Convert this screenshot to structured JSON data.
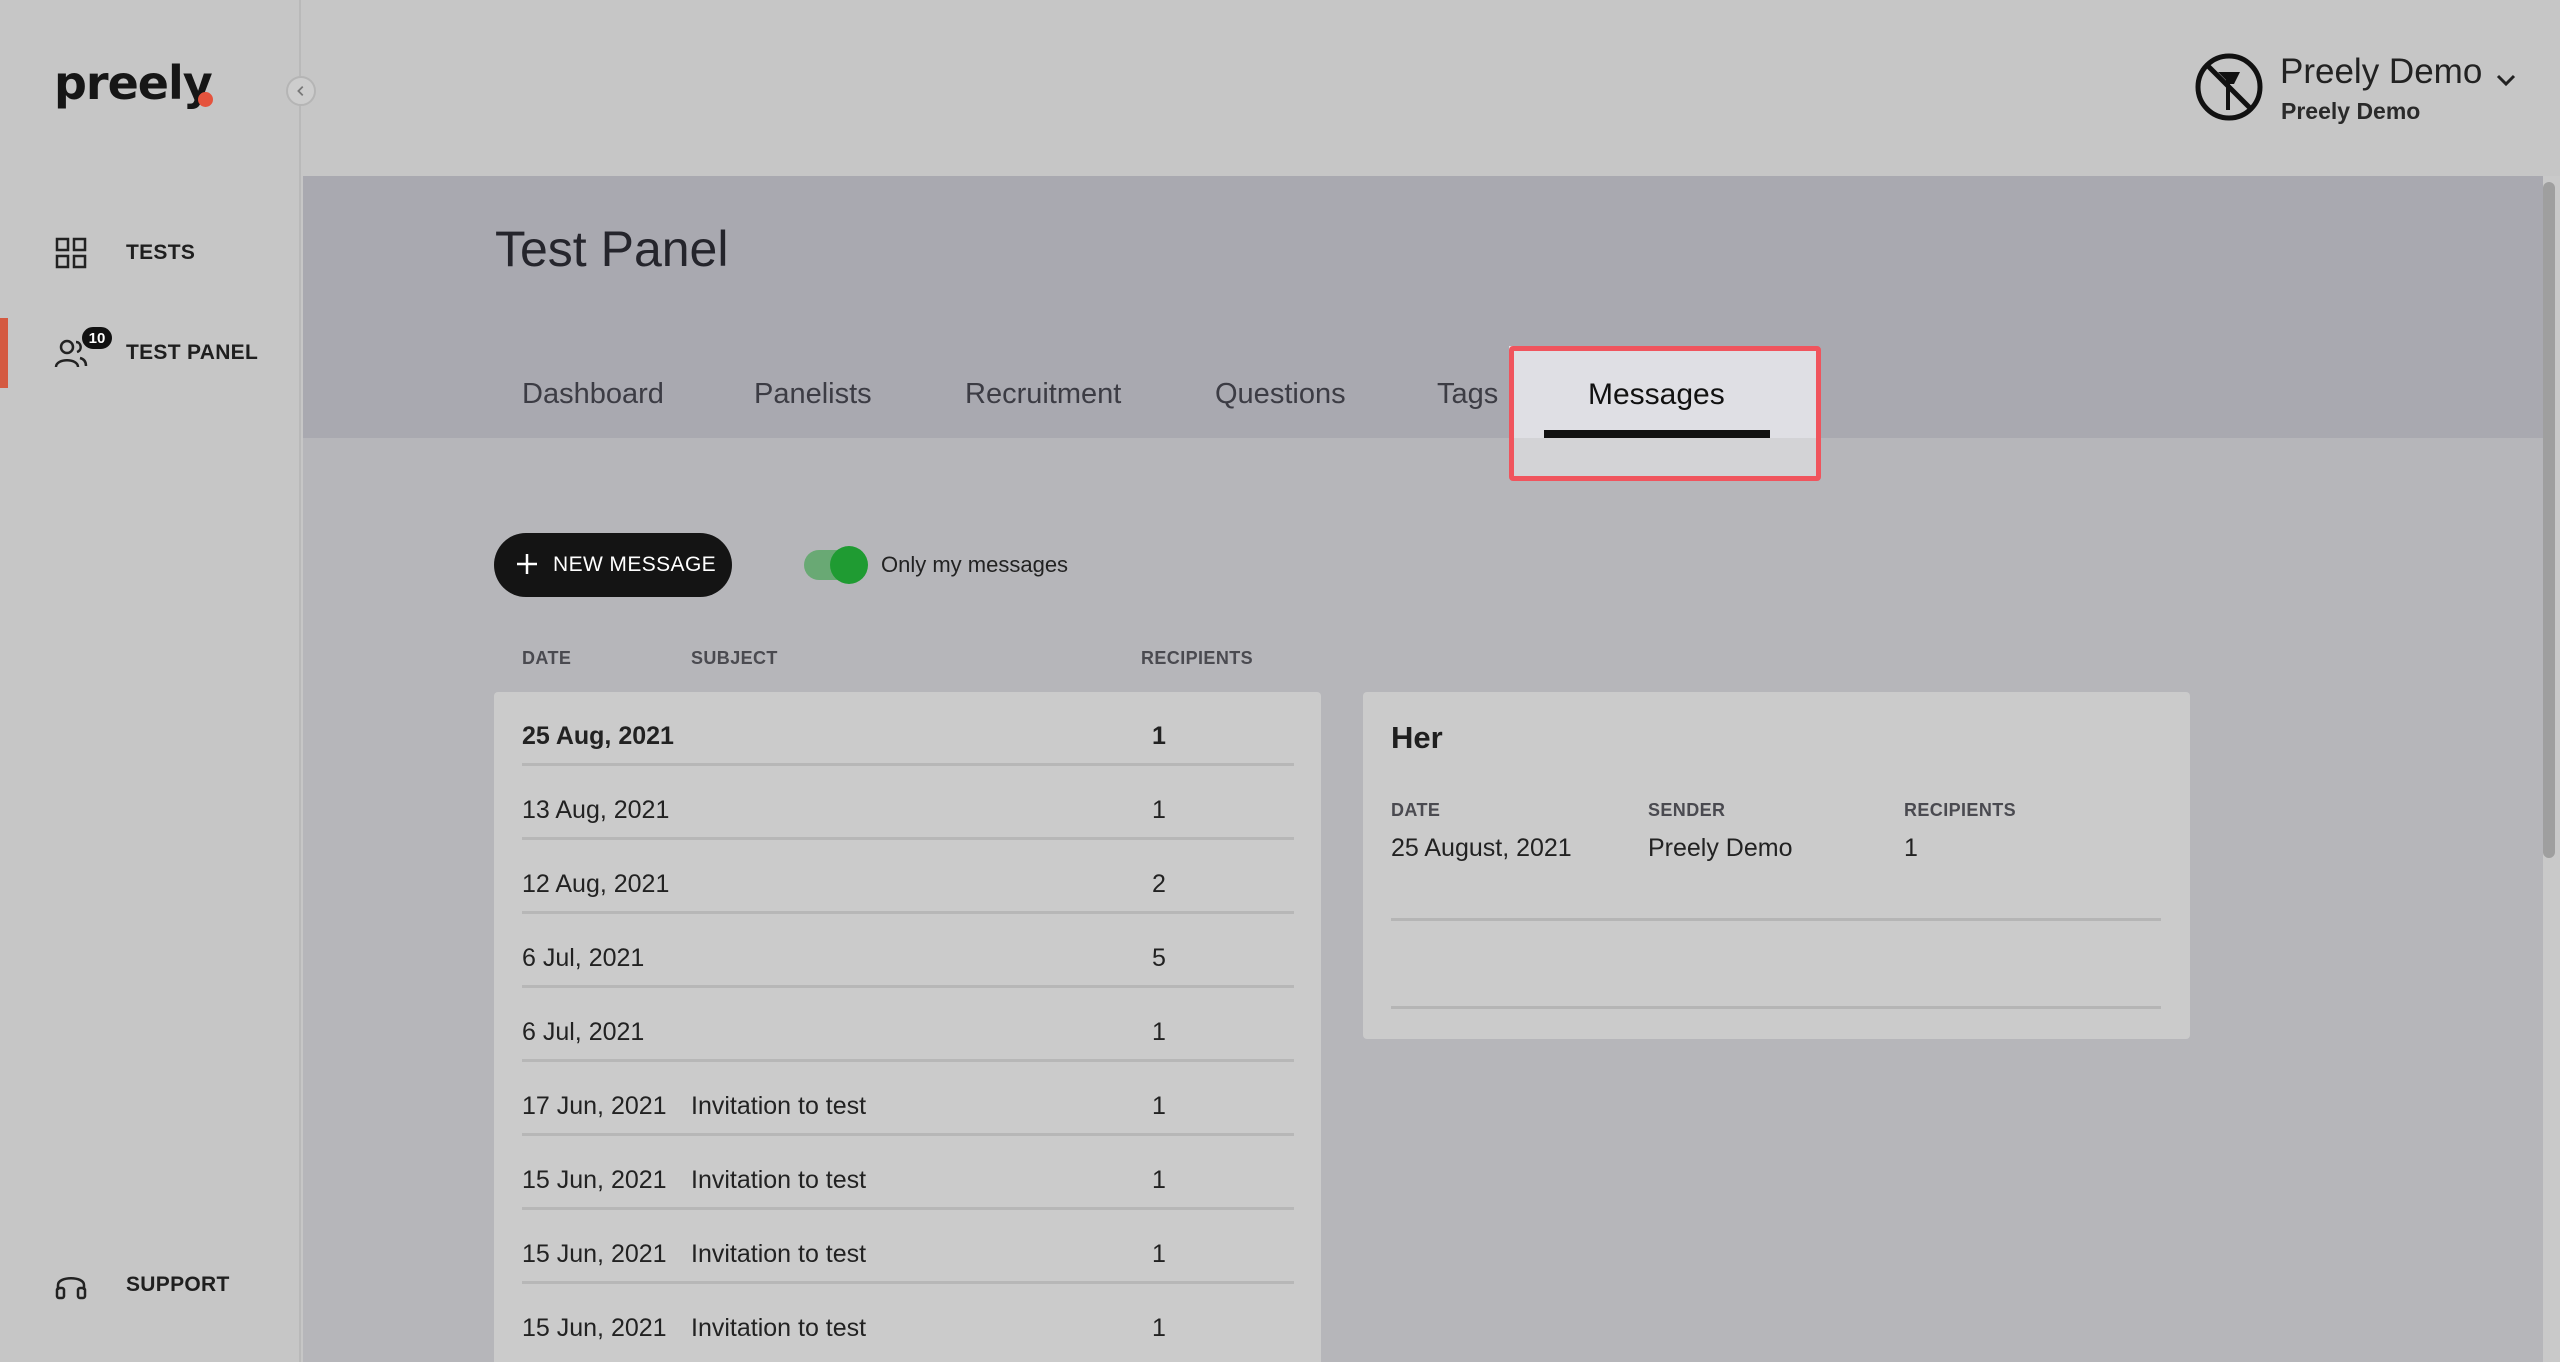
{
  "sidebar": {
    "logo_text": "preely",
    "items": [
      {
        "label": "TESTS",
        "icon": "grid-icon"
      },
      {
        "label": "TEST PANEL",
        "icon": "users-icon",
        "badge": "10",
        "active": true
      }
    ],
    "support_label": "SUPPORT",
    "accent_color": "#d45a41"
  },
  "user": {
    "name": "Preely Demo",
    "org": "Preely Demo"
  },
  "page": {
    "title": "Test Panel",
    "tabs": [
      "Dashboard",
      "Panelists",
      "Recruitment",
      "Questions",
      "Tags",
      "Messages"
    ],
    "active_tab": "Messages"
  },
  "toolbar": {
    "new_message_label": "NEW MESSAGE",
    "toggle_label": "Only my messages",
    "toggle_on": true
  },
  "table": {
    "headers": {
      "date": "DATE",
      "subject": "SUBJECT",
      "recipients": "RECIPIENTS"
    },
    "rows": [
      {
        "date": "25 Aug, 2021",
        "subject": "",
        "recipients": "1"
      },
      {
        "date": "13 Aug, 2021",
        "subject": "",
        "recipients": "1"
      },
      {
        "date": "12 Aug, 2021",
        "subject": "",
        "recipients": "2"
      },
      {
        "date": "6 Jul, 2021",
        "subject": "",
        "recipients": "5"
      },
      {
        "date": "6 Jul, 2021",
        "subject": "",
        "recipients": "1"
      },
      {
        "date": "17 Jun, 2021",
        "subject": "Invitation to test",
        "recipients": "1"
      },
      {
        "date": "15 Jun, 2021",
        "subject": "Invitation to test",
        "recipients": "1"
      },
      {
        "date": "15 Jun, 2021",
        "subject": "Invitation to test",
        "recipients": "1"
      },
      {
        "date": "15 Jun, 2021",
        "subject": "Invitation to test",
        "recipients": "1"
      }
    ]
  },
  "detail": {
    "title": "Her",
    "labels": {
      "date": "DATE",
      "sender": "SENDER",
      "recipients": "RECIPIENTS"
    },
    "values": {
      "date": "25 August, 2021",
      "sender": "Preely Demo",
      "recipients": "1"
    }
  },
  "colors": {
    "highlight": "#f0545d",
    "toggle": "#1f9b32"
  }
}
